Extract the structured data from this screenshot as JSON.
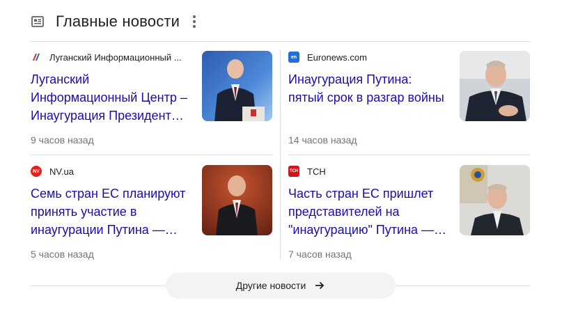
{
  "section": {
    "title": "Главные новости"
  },
  "articles": [
    {
      "source": "Луганский Информационный ...",
      "favicon_color": "#ffffff",
      "headline": "Луганский Информационный Центр – Инаугурация Президент…",
      "time": "9 часов назад"
    },
    {
      "source": "Euronews.com",
      "favicon_text": "en",
      "favicon_color": "#1f6fd6",
      "headline": "Инаугурация Путина: пятый срок в разгар войны",
      "time": "14 часов назад"
    },
    {
      "source": "NV.ua",
      "favicon_text": "NV",
      "favicon_color": "#e2231a",
      "headline": "Семь стран ЕС планируют принять участие в инаугурации Путина —…",
      "time": "5 часов назад"
    },
    {
      "source": "ТСН",
      "favicon_text": "ТСН",
      "favicon_color": "#d4141c",
      "headline": "Часть стран ЕС пришлет представителей на \"инаугурацию\" Путина —…",
      "time": "7 часов назад"
    }
  ],
  "more_button": {
    "label": "Другие новости"
  },
  "colors": {
    "link": "#1a0dab",
    "meta": "#70757a",
    "divider": "#dadce0",
    "button_bg": "#f1f3f4"
  }
}
